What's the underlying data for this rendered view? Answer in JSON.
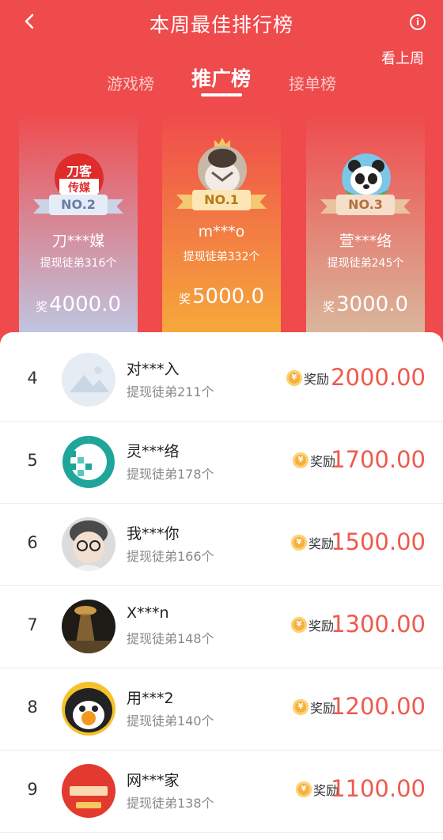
{
  "header": {
    "title": "本周最佳排行榜",
    "last_week": "看上周",
    "back_icon": "chevron-left-icon",
    "info_icon": "info-icon",
    "info_glyph": "i",
    "colors": {
      "bg": "#ef4a4c",
      "accent": "#ee5a4e"
    }
  },
  "tabs": [
    "游戏榜",
    "推广榜",
    "接单榜"
  ],
  "active_tab": "推广榜",
  "podium": [
    {
      "rank_label": "NO.2",
      "name": "刀***媒",
      "count": "提现徒弟316个",
      "award_prefix": "奖",
      "award": "4000.0",
      "avatar_text": [
        "刀客",
        "传媒"
      ]
    },
    {
      "rank_label": "NO.1",
      "name": "m***o",
      "count": "提现徒弟332个",
      "award_prefix": "奖",
      "award": "5000.0"
    },
    {
      "rank_label": "NO.3",
      "name": "萱***络",
      "count": "提现徒弟245个",
      "award_prefix": "奖",
      "award": "3000.0"
    }
  ],
  "list": [
    {
      "rank": "4",
      "name": "对***入",
      "count": "提现徒弟211个",
      "award_label": "奖励",
      "amount": "2000.00"
    },
    {
      "rank": "5",
      "name": "灵***络",
      "count": "提现徒弟178个",
      "award_label": "奖励",
      "amount": "1700.00"
    },
    {
      "rank": "6",
      "name": "我***你",
      "count": "提现徒弟166个",
      "award_label": "奖励",
      "amount": "1500.00"
    },
    {
      "rank": "7",
      "name": "X***n",
      "count": "提现徒弟148个",
      "award_label": "奖励",
      "amount": "1300.00"
    },
    {
      "rank": "8",
      "name": "用***2",
      "count": "提现徒弟140个",
      "award_label": "奖励",
      "amount": "1200.00"
    },
    {
      "rank": "9",
      "name": "网***家",
      "count": "提现徒弟138个",
      "award_label": "奖励",
      "amount": "1100.00"
    }
  ],
  "coin_icon": "coin-icon",
  "coin_glyph": "¥"
}
